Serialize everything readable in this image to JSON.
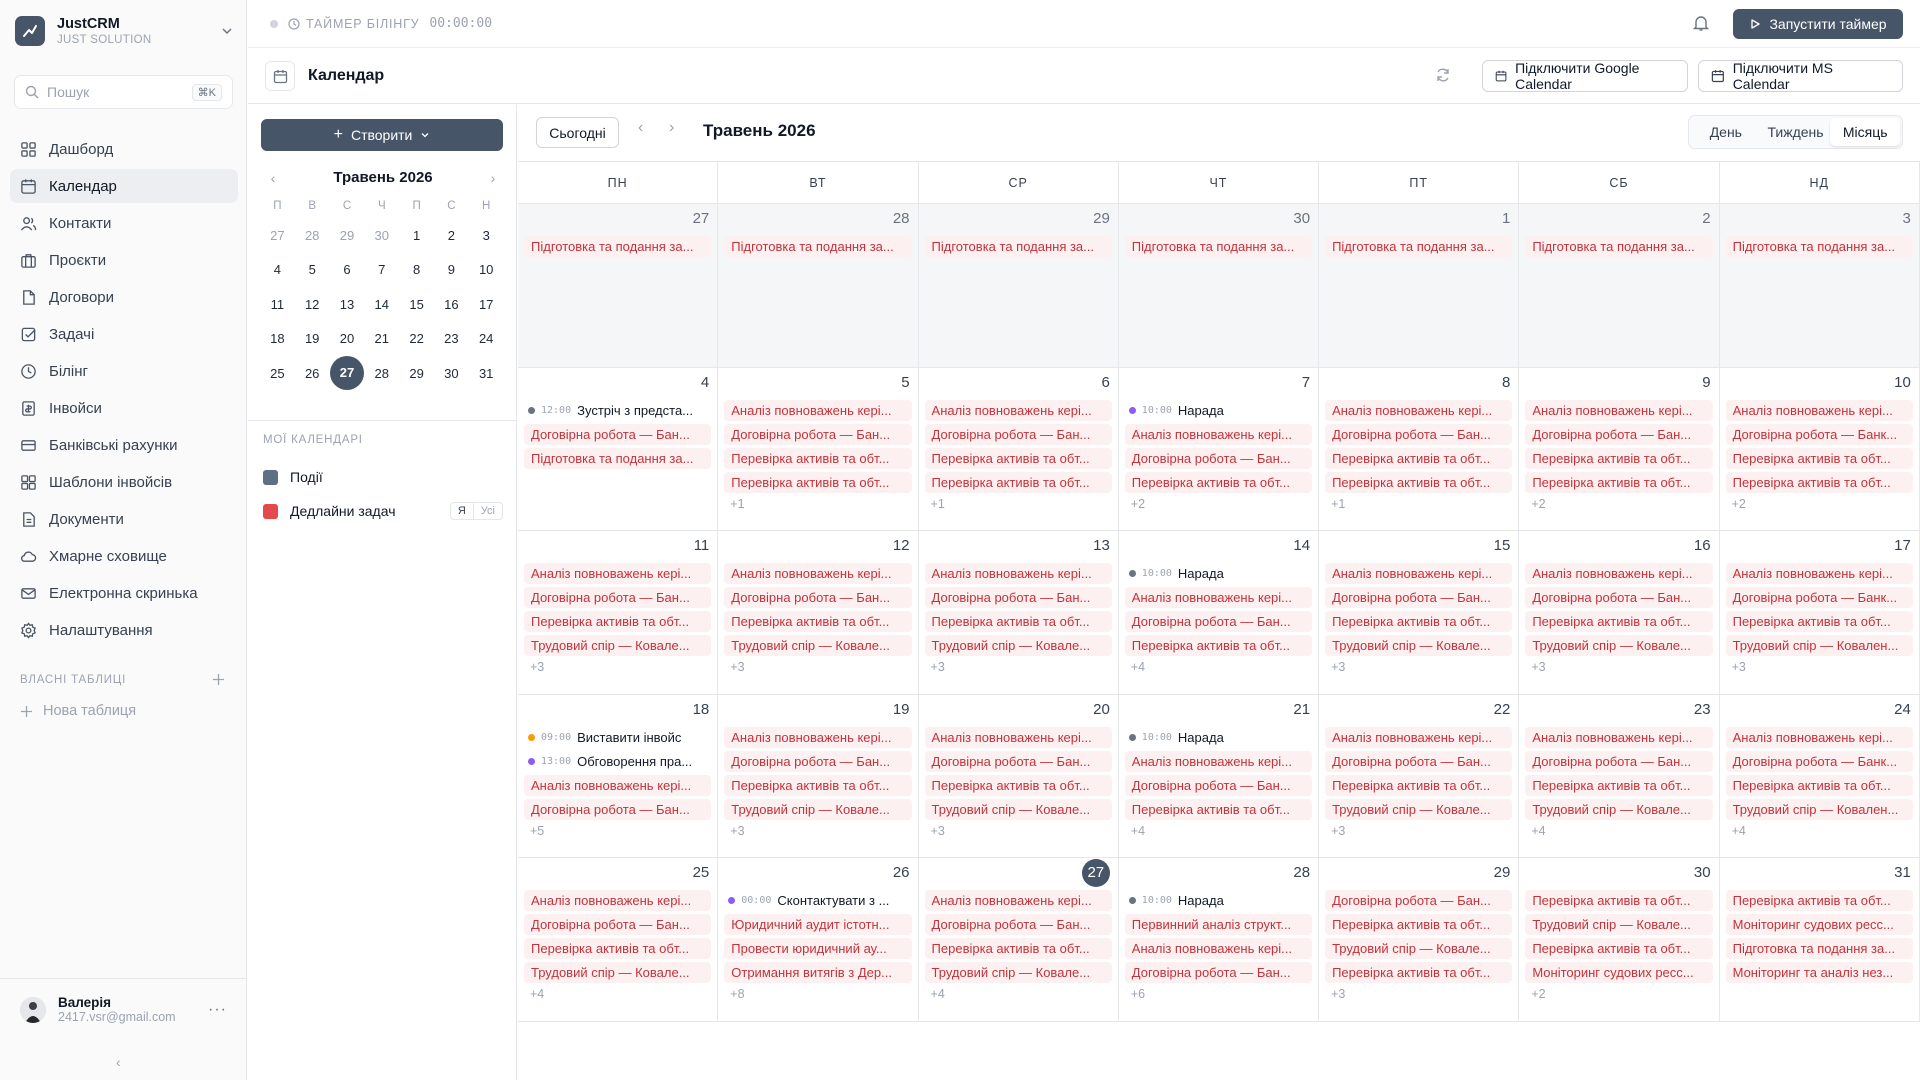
{
  "brand": {
    "name": "JustCRM",
    "subtitle": "JUST SOLUTION"
  },
  "search": {
    "placeholder": "Пошук",
    "shortcut": "⌘K"
  },
  "nav": [
    {
      "label": "Дашборд",
      "icon": "dashboard-icon",
      "active": false
    },
    {
      "label": "Календар",
      "icon": "calendar-icon",
      "active": true
    },
    {
      "label": "Контакти",
      "icon": "contacts-icon",
      "active": false
    },
    {
      "label": "Проєкти",
      "icon": "projects-icon",
      "active": false
    },
    {
      "label": "Договори",
      "icon": "contracts-icon",
      "active": false
    },
    {
      "label": "Задачі",
      "icon": "tasks-icon",
      "active": false
    },
    {
      "label": "Білінг",
      "icon": "billing-icon",
      "active": false
    },
    {
      "label": "Інвойси",
      "icon": "invoices-icon",
      "active": false
    },
    {
      "label": "Банківські рахунки",
      "icon": "bank-accounts-icon",
      "active": false
    },
    {
      "label": "Шаблони інвойсів",
      "icon": "invoice-templates-icon",
      "active": false
    },
    {
      "label": "Документи",
      "icon": "documents-icon",
      "active": false
    },
    {
      "label": "Хмарне сховище",
      "icon": "cloud-icon",
      "active": false
    },
    {
      "label": "Електронна скринька",
      "icon": "mail-icon",
      "active": false
    },
    {
      "label": "Налаштування",
      "icon": "settings-icon",
      "active": false
    }
  ],
  "custom_tables": {
    "heading": "ВЛАСНІ ТАБЛИЦІ",
    "new_label": "Нова таблиця"
  },
  "user": {
    "name": "Валерія",
    "email": "2417.vsr@gmail.com"
  },
  "timer": {
    "label": "ТАЙМЕР БІЛІНГУ",
    "time": "00:00:00",
    "start_label": "Запустити таймер"
  },
  "page": {
    "title": "Календар",
    "google_btn": "Підключити Google Calendar",
    "ms_btn": "Підключити MS Calendar"
  },
  "create_label": "Створити",
  "mini": {
    "title": "Травень 2026",
    "dow": [
      "П",
      "В",
      "С",
      "Ч",
      "П",
      "С",
      "Н"
    ],
    "weeks": [
      [
        {
          "d": "27",
          "m": true
        },
        {
          "d": "28",
          "m": true
        },
        {
          "d": "29",
          "m": true
        },
        {
          "d": "30",
          "m": true
        },
        {
          "d": "1"
        },
        {
          "d": "2"
        },
        {
          "d": "3"
        }
      ],
      [
        {
          "d": "4"
        },
        {
          "d": "5"
        },
        {
          "d": "6"
        },
        {
          "d": "7"
        },
        {
          "d": "8"
        },
        {
          "d": "9"
        },
        {
          "d": "10"
        }
      ],
      [
        {
          "d": "11"
        },
        {
          "d": "12"
        },
        {
          "d": "13"
        },
        {
          "d": "14"
        },
        {
          "d": "15"
        },
        {
          "d": "16"
        },
        {
          "d": "17"
        }
      ],
      [
        {
          "d": "18"
        },
        {
          "d": "19"
        },
        {
          "d": "20"
        },
        {
          "d": "21"
        },
        {
          "d": "22"
        },
        {
          "d": "23"
        },
        {
          "d": "24"
        }
      ],
      [
        {
          "d": "25"
        },
        {
          "d": "26"
        },
        {
          "d": "27",
          "t": true
        },
        {
          "d": "28"
        },
        {
          "d": "29"
        },
        {
          "d": "30"
        },
        {
          "d": "31"
        }
      ]
    ]
  },
  "calendars": {
    "heading": "МОЇ КАЛЕНДАРІ",
    "items": [
      {
        "label": "Події",
        "color": "#5f6f84"
      },
      {
        "label": "Дедлайни задач",
        "color": "#e5484d",
        "seg": [
          "Я",
          "Усі"
        ]
      }
    ]
  },
  "toolbar": {
    "today": "Сьогодні",
    "month_title": "Травень 2026",
    "views": [
      "День",
      "Тиждень",
      "Місяць"
    ],
    "active_view": 2
  },
  "dow": [
    "ПН",
    "ВТ",
    "СР",
    "ЧТ",
    "ПТ",
    "СБ",
    "НД"
  ],
  "weeks": [
    [
      {
        "d": "27",
        "out": true,
        "ev": [
          {
            "x": "Підготовка та подання за..."
          }
        ]
      },
      {
        "d": "28",
        "out": true,
        "ev": [
          {
            "x": "Підготовка та подання за..."
          }
        ]
      },
      {
        "d": "29",
        "out": true,
        "ev": [
          {
            "x": "Підготовка та подання за..."
          }
        ]
      },
      {
        "d": "30",
        "out": true,
        "ev": [
          {
            "x": "Підготовка та подання за..."
          }
        ]
      },
      {
        "d": "1",
        "out": true,
        "ev": [
          {
            "x": "Підготовка та подання за..."
          }
        ]
      },
      {
        "d": "2",
        "out": true,
        "ev": [
          {
            "x": "Підготовка та подання за..."
          }
        ]
      },
      {
        "d": "3",
        "out": true,
        "ev": [
          {
            "x": "Підготовка та подання за..."
          }
        ]
      }
    ],
    [
      {
        "d": "4",
        "ev": [
          {
            "t": "12:00",
            "c": "#6b7280",
            "x": "Зустріч з предста..."
          },
          {
            "x": "Договірна робота — Бан..."
          },
          {
            "x": "Підготовка та подання за..."
          }
        ]
      },
      {
        "d": "5",
        "ev": [
          {
            "x": "Аналіз повноважень кері..."
          },
          {
            "x": "Договірна робота — Бан..."
          },
          {
            "x": "Перевірка активів та обт..."
          },
          {
            "x": "Перевірка активів та обт..."
          }
        ],
        "more": "+1"
      },
      {
        "d": "6",
        "ev": [
          {
            "x": "Аналіз повноважень кері..."
          },
          {
            "x": "Договірна робота — Бан..."
          },
          {
            "x": "Перевірка активів та обт..."
          },
          {
            "x": "Перевірка активів та обт..."
          }
        ],
        "more": "+1"
      },
      {
        "d": "7",
        "ev": [
          {
            "t": "10:00",
            "c": "#8b5cf6",
            "x": "Нарада"
          },
          {
            "x": "Аналіз повноважень кері..."
          },
          {
            "x": "Договірна робота — Бан..."
          },
          {
            "x": "Перевірка активів та обт..."
          }
        ],
        "more": "+2"
      },
      {
        "d": "8",
        "ev": [
          {
            "x": "Аналіз повноважень кері..."
          },
          {
            "x": "Договірна робота — Бан..."
          },
          {
            "x": "Перевірка активів та обт..."
          },
          {
            "x": "Перевірка активів та обт..."
          }
        ],
        "more": "+1"
      },
      {
        "d": "9",
        "ev": [
          {
            "x": "Аналіз повноважень кері..."
          },
          {
            "x": "Договірна робота — Бан..."
          },
          {
            "x": "Перевірка активів та обт..."
          },
          {
            "x": "Перевірка активів та обт..."
          }
        ],
        "more": "+2"
      },
      {
        "d": "10",
        "ev": [
          {
            "x": "Аналіз повноважень кері..."
          },
          {
            "x": "Договірна робота — Банк..."
          },
          {
            "x": "Перевірка активів та обт..."
          },
          {
            "x": "Перевірка активів та обт..."
          }
        ],
        "more": "+2"
      }
    ],
    [
      {
        "d": "11",
        "ev": [
          {
            "x": "Аналіз повноважень кері..."
          },
          {
            "x": "Договірна робота — Бан..."
          },
          {
            "x": "Перевірка активів та обт..."
          },
          {
            "x": "Трудовий спір — Ковале..."
          }
        ],
        "more": "+3"
      },
      {
        "d": "12",
        "ev": [
          {
            "x": "Аналіз повноважень кері..."
          },
          {
            "x": "Договірна робота — Бан..."
          },
          {
            "x": "Перевірка активів та обт..."
          },
          {
            "x": "Трудовий спір — Ковале..."
          }
        ],
        "more": "+3"
      },
      {
        "d": "13",
        "ev": [
          {
            "x": "Аналіз повноважень кері..."
          },
          {
            "x": "Договірна робота — Бан..."
          },
          {
            "x": "Перевірка активів та обт..."
          },
          {
            "x": "Трудовий спір — Ковале..."
          }
        ],
        "more": "+3"
      },
      {
        "d": "14",
        "ev": [
          {
            "t": "10:00",
            "c": "#6b7280",
            "x": "Нарада"
          },
          {
            "x": "Аналіз повноважень кері..."
          },
          {
            "x": "Договірна робота — Бан..."
          },
          {
            "x": "Перевірка активів та обт..."
          }
        ],
        "more": "+4"
      },
      {
        "d": "15",
        "ev": [
          {
            "x": "Аналіз повноважень кері..."
          },
          {
            "x": "Договірна робота — Бан..."
          },
          {
            "x": "Перевірка активів та обт..."
          },
          {
            "x": "Трудовий спір — Ковале..."
          }
        ],
        "more": "+3"
      },
      {
        "d": "16",
        "ev": [
          {
            "x": "Аналіз повноважень кері..."
          },
          {
            "x": "Договірна робота — Бан..."
          },
          {
            "x": "Перевірка активів та обт..."
          },
          {
            "x": "Трудовий спір — Ковале..."
          }
        ],
        "more": "+3"
      },
      {
        "d": "17",
        "ev": [
          {
            "x": "Аналіз повноважень кері..."
          },
          {
            "x": "Договірна робота — Банк..."
          },
          {
            "x": "Перевірка активів та обт..."
          },
          {
            "x": "Трудовий спір — Ковален..."
          }
        ],
        "more": "+3"
      }
    ],
    [
      {
        "d": "18",
        "ev": [
          {
            "t": "09:00",
            "c": "#f59e0b",
            "x": "Виставити інвойс"
          },
          {
            "t": "13:00",
            "c": "#8b5cf6",
            "x": "Обговорення пра..."
          },
          {
            "x": "Аналіз повноважень кері..."
          },
          {
            "x": "Договірна робота — Бан..."
          }
        ],
        "more": "+5"
      },
      {
        "d": "19",
        "ev": [
          {
            "x": "Аналіз повноважень кері..."
          },
          {
            "x": "Договірна робота — Бан..."
          },
          {
            "x": "Перевірка активів та обт..."
          },
          {
            "x": "Трудовий спір — Ковале..."
          }
        ],
        "more": "+3"
      },
      {
        "d": "20",
        "ev": [
          {
            "x": "Аналіз повноважень кері..."
          },
          {
            "x": "Договірна робота — Бан..."
          },
          {
            "x": "Перевірка активів та обт..."
          },
          {
            "x": "Трудовий спір — Ковале..."
          }
        ],
        "more": "+3"
      },
      {
        "d": "21",
        "ev": [
          {
            "t": "10:00",
            "c": "#6b7280",
            "x": "Нарада"
          },
          {
            "x": "Аналіз повноважень кері..."
          },
          {
            "x": "Договірна робота — Бан..."
          },
          {
            "x": "Перевірка активів та обт..."
          }
        ],
        "more": "+4"
      },
      {
        "d": "22",
        "ev": [
          {
            "x": "Аналіз повноважень кері..."
          },
          {
            "x": "Договірна робота — Бан..."
          },
          {
            "x": "Перевірка активів та обт..."
          },
          {
            "x": "Трудовий спір — Ковале..."
          }
        ],
        "more": "+3"
      },
      {
        "d": "23",
        "ev": [
          {
            "x": "Аналіз повноважень кері..."
          },
          {
            "x": "Договірна робота — Бан..."
          },
          {
            "x": "Перевірка активів та обт..."
          },
          {
            "x": "Трудовий спір — Ковале..."
          }
        ],
        "more": "+4"
      },
      {
        "d": "24",
        "ev": [
          {
            "x": "Аналіз повноважень кері..."
          },
          {
            "x": "Договірна робота — Банк..."
          },
          {
            "x": "Перевірка активів та обт..."
          },
          {
            "x": "Трудовий спір — Ковален..."
          }
        ],
        "more": "+4"
      }
    ],
    [
      {
        "d": "25",
        "ev": [
          {
            "x": "Аналіз повноважень кері..."
          },
          {
            "x": "Договірна робота — Бан..."
          },
          {
            "x": "Перевірка активів та обт..."
          },
          {
            "x": "Трудовий спір — Ковале..."
          }
        ],
        "more": "+4"
      },
      {
        "d": "26",
        "ev": [
          {
            "t": "00:00",
            "c": "#8b5cf6",
            "x": "Сконтактувати з ..."
          },
          {
            "x": "Юридичний аудит істотн..."
          },
          {
            "x": "Провести юридичний ау..."
          },
          {
            "x": "Отримання витягів з Дер..."
          }
        ],
        "more": "+8"
      },
      {
        "d": "27",
        "today": true,
        "ev": [
          {
            "x": "Аналіз повноважень кері..."
          },
          {
            "x": "Договірна робота — Бан..."
          },
          {
            "x": "Перевірка активів та обт..."
          },
          {
            "x": "Трудовий спір — Ковале..."
          }
        ],
        "more": "+4"
      },
      {
        "d": "28",
        "ev": [
          {
            "t": "10:00",
            "c": "#6b7280",
            "x": "Нарада"
          },
          {
            "x": "Первинний аналіз структ..."
          },
          {
            "x": "Аналіз повноважень кері..."
          },
          {
            "x": "Договірна робота — Бан..."
          }
        ],
        "more": "+6"
      },
      {
        "d": "29",
        "ev": [
          {
            "x": "Договірна робота — Бан..."
          },
          {
            "x": "Перевірка активів та обт..."
          },
          {
            "x": "Трудовий спір — Ковале..."
          },
          {
            "x": "Перевірка активів та обт..."
          }
        ],
        "more": "+3"
      },
      {
        "d": "30",
        "ev": [
          {
            "x": "Перевірка активів та обт..."
          },
          {
            "x": "Трудовий спір — Ковале..."
          },
          {
            "x": "Перевірка активів та обт..."
          },
          {
            "x": "Моніторинг судових ресс..."
          }
        ],
        "more": "+2"
      },
      {
        "d": "31",
        "ev": [
          {
            "x": "Перевірка активів та обт..."
          },
          {
            "x": "Моніторинг судових ресс..."
          },
          {
            "x": "Підготовка та подання за..."
          },
          {
            "x": "Моніторинг та аналіз нез..."
          }
        ]
      }
    ]
  ]
}
